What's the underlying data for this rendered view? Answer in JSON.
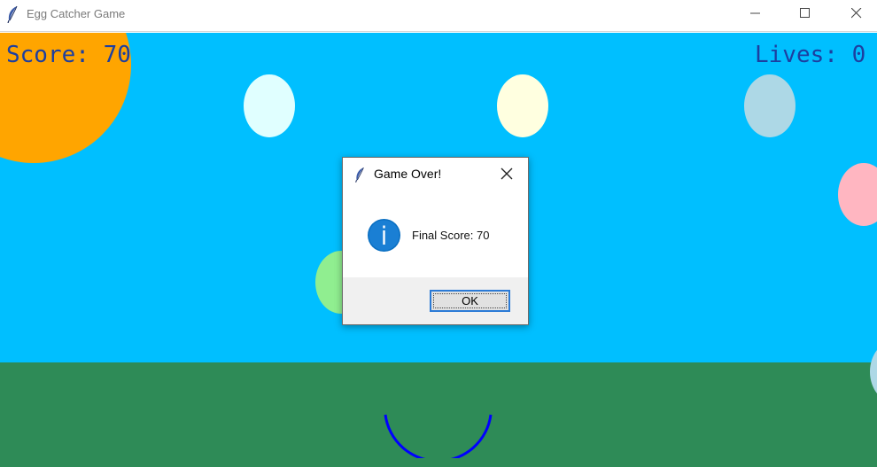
{
  "window": {
    "title": "Egg Catcher Game",
    "app_icon": "feather-icon",
    "controls": [
      "minimize-icon",
      "maximize-icon",
      "close-icon"
    ]
  },
  "hud": {
    "score_text": "Score: 70",
    "lives_text": "Lives: 0"
  },
  "dialog": {
    "title": "Game Over!",
    "icon": "info-icon",
    "message": "Final Score: 70",
    "ok_label": "OK"
  },
  "colors": {
    "sky": "#00bfff",
    "ground": "#2e8b57",
    "sun": "#ffa500",
    "hud_text": "#1d3fa0",
    "catcher": "#0000ff",
    "info_blue": "#0a6fc2",
    "eggs": [
      "#e0ffff",
      "#ffffe0",
      "#add8e6",
      "#ffb6c1",
      "#90ee90",
      "#add8e6"
    ]
  }
}
